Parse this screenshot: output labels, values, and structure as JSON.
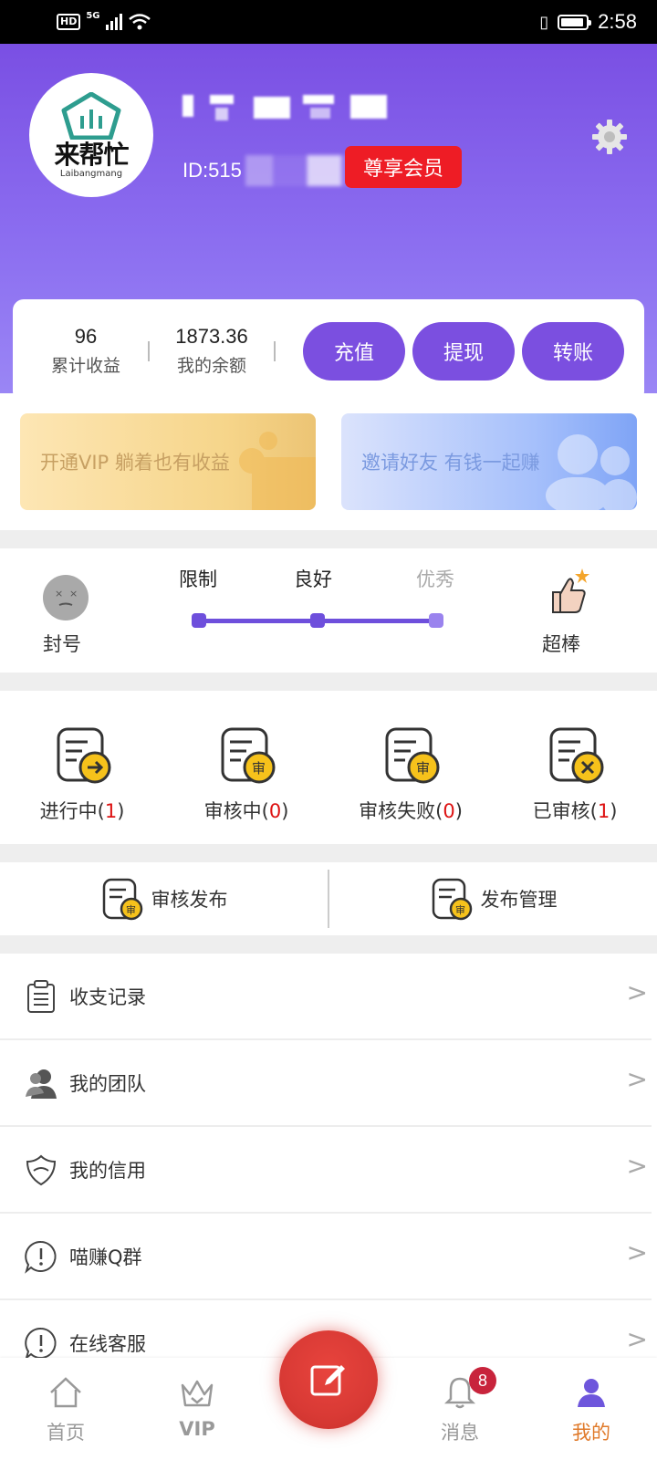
{
  "status_bar": {
    "hd": "HD",
    "network": "5G",
    "time": "2:58"
  },
  "profile": {
    "logo_cn": "来帮忙",
    "logo_en": "Laibangmang",
    "id_prefix": "ID:515",
    "member_badge": "尊享会员"
  },
  "stats": {
    "earnings_value": "96",
    "earnings_label": "累计收益",
    "balance_value": "1873.36",
    "balance_label": "我的余额",
    "buttons": [
      "充值",
      "提现",
      "转账"
    ]
  },
  "promos": {
    "vip": "开通VIP 躺着也有收益",
    "invite": "邀请好友 有钱一起赚"
  },
  "credit": {
    "left_label": "封号",
    "levels": [
      "限制",
      "良好",
      "优秀"
    ],
    "right_label": "超棒"
  },
  "tasks": [
    {
      "label": "进行中",
      "count": "1"
    },
    {
      "label": "审核中",
      "count": "0"
    },
    {
      "label": "审核失败",
      "count": "0"
    },
    {
      "label": "已审核",
      "count": "1"
    }
  ],
  "publish": {
    "review": "审核发布",
    "manage": "发布管理"
  },
  "menu": {
    "items": [
      "收支记录",
      "我的团队",
      "我的信用",
      "喵赚Q群",
      "在线客服"
    ],
    "arrow": ">"
  },
  "tabbar": {
    "tabs": [
      "首页",
      "VIP",
      "",
      "消息",
      "我的"
    ],
    "message_badge": "8",
    "active_tab": "我的",
    "active_color": "#e07a2a"
  },
  "colors": {
    "primary": "#7b4fe0",
    "badge_red": "#ee1c25",
    "fab_red": "#d93a35"
  },
  "icons": [
    "settings-gear-icon",
    "hd-icon",
    "signal-icon",
    "wifi-icon",
    "vibrate-icon",
    "battery-icon",
    "sad-face-icon",
    "thumbs-up-icon",
    "document-arrow-icon",
    "document-review-icon",
    "document-cross-icon",
    "clipboard-icon",
    "team-icon",
    "shield-icon",
    "chat-alert-icon",
    "home-icon",
    "crown-icon",
    "edit-icon",
    "bell-icon",
    "user-icon"
  ]
}
